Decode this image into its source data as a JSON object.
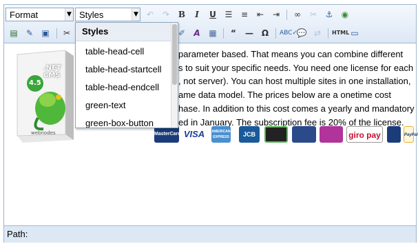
{
  "toolbar": {
    "format_label": "Format",
    "styles_label": "Styles"
  },
  "icons": [
    "undo-icon",
    "redo-icon",
    "bold-icon",
    "italic-icon",
    "underline-icon",
    "bulleted-list-icon",
    "numbered-list-icon",
    "outdent-icon",
    "indent-icon",
    "link-icon",
    "unlink-icon",
    "anchor-icon",
    "image-icon",
    "cut-icon",
    "special-char-icon",
    "spellcheck-icon",
    "html-source-icon"
  ],
  "dropdown": {
    "title": "Styles",
    "items": [
      "table-head-cell",
      "table-head-startcell",
      "table-head-endcell",
      "green-text",
      "green-box-button"
    ]
  },
  "content": {
    "product_box_text": ".NET CMS",
    "product_version": "4.5",
    "product_brand": "webnodes",
    "lines": [
      "parameter based. That means you can combine different",
      "s to suit your specific needs. You need one license for each",
      ", not server). You can host multiple sites in one installation,",
      "ame data model. The prices below are a onetime cost",
      "hase. In addition to this cost comes a yearly and mandatory",
      "ed in January. The subscription fee is 20% of the license."
    ],
    "payments": [
      "MasterCard",
      "VISA",
      "AMERICAN EXPRESS",
      "JCB",
      "",
      "",
      "",
      "giro pay",
      "",
      "PayPal"
    ]
  },
  "statusbar": {
    "path_label": "Path:"
  },
  "colors": {
    "border": "#9eb6ce",
    "toolbar": "#dde8f5",
    "green": "#3aa53a"
  }
}
